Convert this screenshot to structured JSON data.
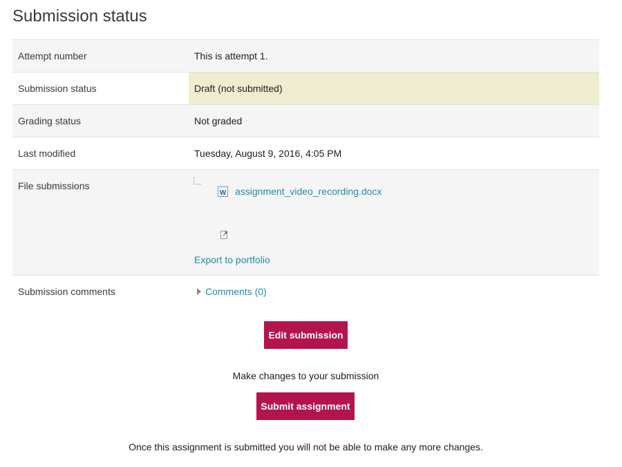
{
  "page_title": "Submission status",
  "rows": {
    "attempt": {
      "label": "Attempt number",
      "value": "This is attempt 1."
    },
    "status": {
      "label": "Submission status",
      "value": "Draft (not submitted)"
    },
    "grading": {
      "label": "Grading status",
      "value": "Not graded"
    },
    "modified": {
      "label": "Last modified",
      "value": "Tuesday, August 9, 2016, 4:05 PM"
    },
    "files": {
      "label": "File submissions",
      "file_name": "assignment_video_recording.docx",
      "export_label": "Export to portfolio"
    },
    "comments": {
      "label": "Submission comments",
      "link": "Comments (0)"
    }
  },
  "actions": {
    "edit_label": "Edit submission",
    "edit_note": "Make changes to your submission",
    "submit_label": "Submit assignment",
    "submit_note": "Once this assignment is submitted you will not be able to make any more changes."
  },
  "colors": {
    "primary_button": "#b3144d",
    "link": "#1f8ea8",
    "draft_highlight": "#efeccf"
  },
  "icons": {
    "file": "word-document-icon",
    "portfolio": "export-portfolio-icon",
    "expand": "triangle-right-icon"
  }
}
